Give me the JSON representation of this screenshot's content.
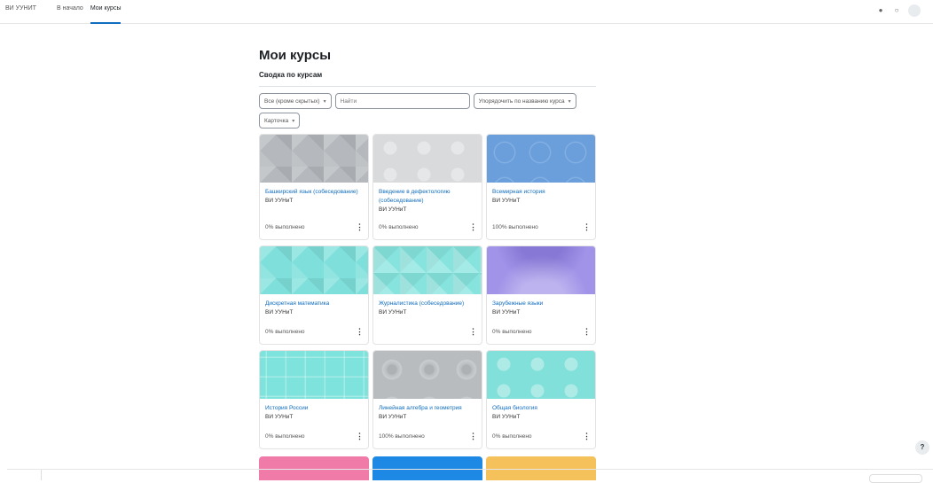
{
  "header": {
    "brand": "ВИ УУНИТ",
    "nav": [
      {
        "label": "В начало",
        "active": false
      },
      {
        "label": "Мои курсы",
        "active": true
      }
    ]
  },
  "main": {
    "title": "Мои курсы",
    "section_title": "Сводка по курсам",
    "filters": {
      "grouping": "Все (кроме скрытых)",
      "search_placeholder": "Найти",
      "sort": "Упорядочить по названию курса",
      "view": "Карточка"
    },
    "courses": [
      {
        "name": "Башкирский язык (собеседование)",
        "category": "ВИ УУНиТ",
        "progress": "0% выполнено",
        "color": "#b5b9bd"
      },
      {
        "name": "Введение в дефектологию (собеседование)",
        "category": "ВИ УУНиТ",
        "progress": "0% выполнено",
        "color": "#d8dadb"
      },
      {
        "name": "Всемирная история",
        "category": "ВИ УУНиТ",
        "progress": "100% выполнено",
        "color": "#6a9fdc"
      },
      {
        "name": "Дискретная математика",
        "category": "ВИ УУНиТ",
        "progress": "0% выполнено",
        "color": "#7fe0db"
      },
      {
        "name": "Журналистика (собеседование)",
        "category": "ВИ УУНиТ",
        "progress": "",
        "color": "#86e3dd"
      },
      {
        "name": "Зарубежные языки",
        "category": "ВИ УУНиТ",
        "progress": "0% выполнено",
        "color": "#a193e8"
      },
      {
        "name": "История России",
        "category": "ВИ УУНиТ",
        "progress": "0% выполнено",
        "color": "#7ee2dd"
      },
      {
        "name": "Линейная алгебра и геометрия",
        "category": "ВИ УУНиТ",
        "progress": "100% выполнено",
        "color": "#b8bcbf"
      },
      {
        "name": "Общая биология",
        "category": "ВИ УУНиТ",
        "progress": "0% выполнено",
        "color": "#82e0da"
      }
    ],
    "partial_cards": [
      {
        "color": "#f07aa8"
      },
      {
        "color": "#1e88e5"
      },
      {
        "color": "#f5c15a"
      }
    ]
  },
  "help_label": "?"
}
